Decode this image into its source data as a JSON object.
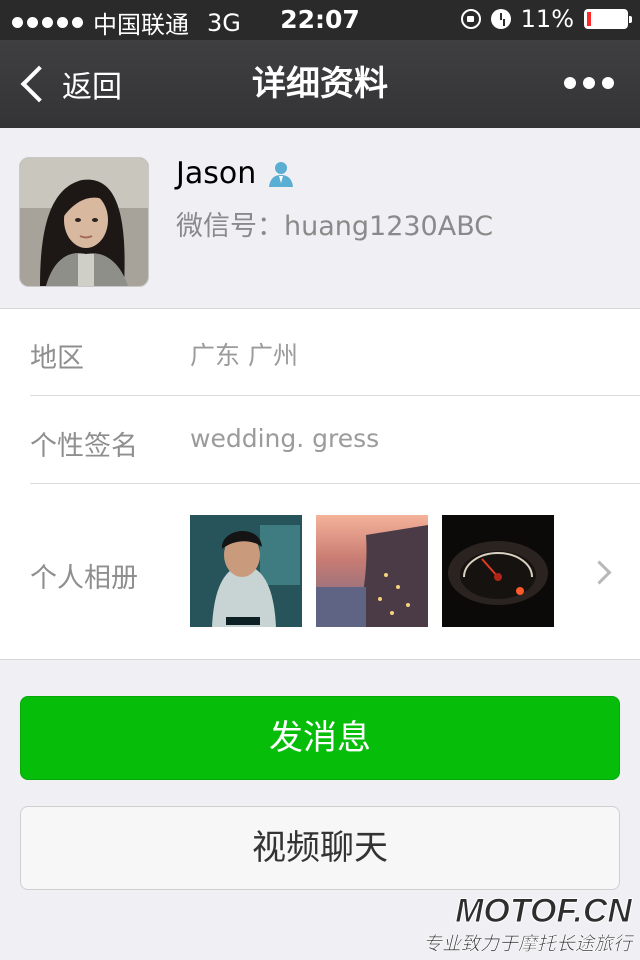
{
  "status_bar": {
    "carrier": "中国联通",
    "network": "3G",
    "time": "22:07",
    "battery": "11%",
    "battery_level": 0.11,
    "battery_color": "#ff2a2a"
  },
  "nav": {
    "back_label": "返回",
    "title": "详细资料",
    "more_icon": "more-dots-icon"
  },
  "profile": {
    "name": "Jason",
    "wechat_id": "微信号：huang1230ABC",
    "contact_icon": "contact-person-icon"
  },
  "info": {
    "region_label": "地区",
    "region_value": "广东  广州",
    "signature_label": "个性签名",
    "signature_value": "wedding. gress",
    "album_label": "个人相册",
    "album_photos": [
      "photo-1",
      "photo-2",
      "photo-3"
    ]
  },
  "actions": {
    "send_message": "发消息",
    "video_chat": "视频聊天",
    "send_color": "#06be0a"
  },
  "watermark": {
    "logo": "MOTOF.CN",
    "slogan": "专业致力于摩托长途旅行"
  }
}
